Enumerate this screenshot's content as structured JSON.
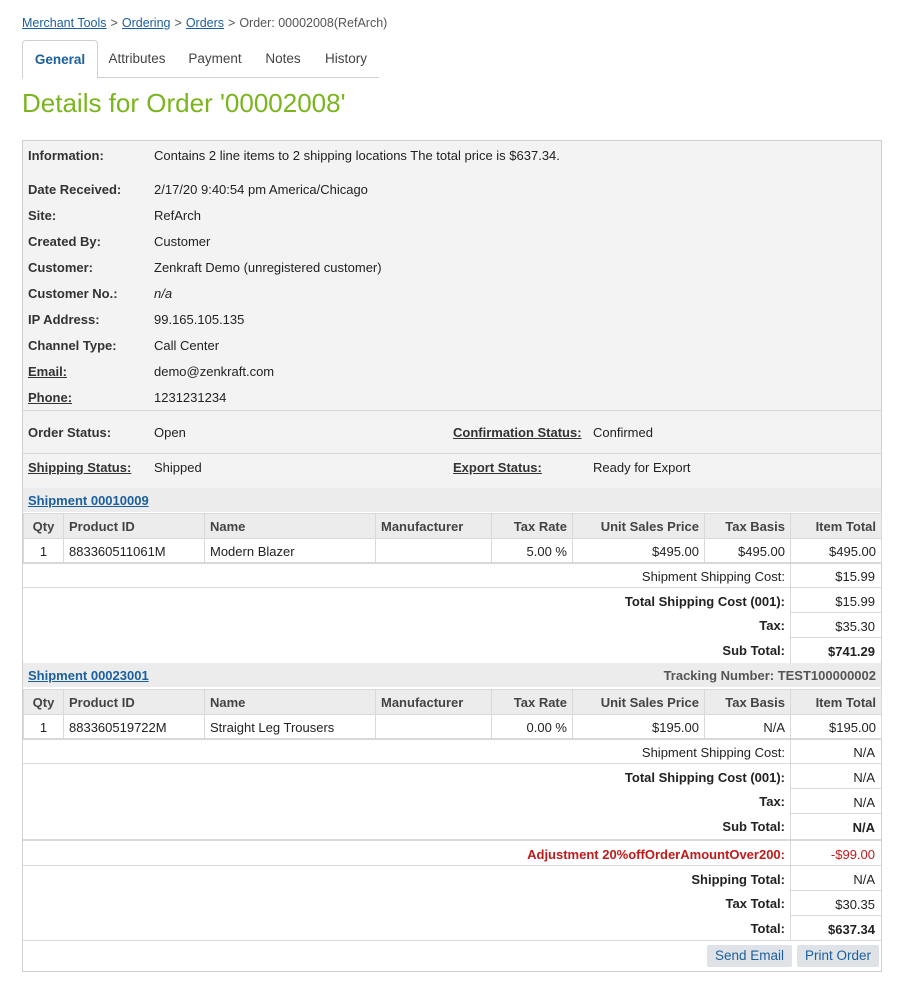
{
  "breadcrumb": {
    "merchant_tools": "Merchant Tools",
    "ordering": "Ordering",
    "orders": "Orders",
    "current": "Order: 00002008(RefArch)",
    "sep": ">"
  },
  "tabs": [
    "General",
    "Attributes",
    "Payment",
    "Notes",
    "History"
  ],
  "title": "Details for Order '00002008'",
  "info": {
    "information_label": "Information:",
    "information_value": "Contains 2 line items to 2 shipping locations The total price is $637.34.",
    "date_label": "Date Received:",
    "date_value": "2/17/20 9:40:54 pm America/Chicago",
    "site_label": "Site:",
    "site_value": "RefArch",
    "created_label": "Created By:",
    "created_value": "Customer",
    "customer_label": "Customer:",
    "customer_value": "Zenkraft Demo (unregistered customer)",
    "customer_no_label": "Customer No.:",
    "customer_no_value": "n/a",
    "ip_label": "IP Address:",
    "ip_value": "99.165.105.135",
    "channel_label": "Channel Type:",
    "channel_value": "Call Center",
    "email_label": "Email:",
    "email_value": "demo@zenkraft.com",
    "phone_label": "Phone:",
    "phone_value": "1231231234"
  },
  "status": {
    "order_label": "Order Status:",
    "order_value": "Open",
    "confirmation_label": "Confirmation Status:",
    "confirmation_value": "Confirmed",
    "shipping_label": "Shipping Status:",
    "shipping_value": "Shipped",
    "export_label": "Export Status:",
    "export_value": "Ready for Export"
  },
  "columns": [
    "Qty",
    "Product ID",
    "Name",
    "Manufacturer",
    "Tax Rate",
    "Unit Sales Price",
    "Tax Basis",
    "Item Total"
  ],
  "shipment1": {
    "name": "Shipment 00010009",
    "item": {
      "qty": "1",
      "product_id": "883360511061M",
      "name": "Modern Blazer",
      "manufacturer": "",
      "tax_rate": "5.00 %",
      "unit_price": "$495.00",
      "tax_basis": "$495.00",
      "item_total": "$495.00"
    },
    "ship_cost_label": "Shipment Shipping Cost:",
    "ship_cost": "$15.99",
    "total_ship_label": "Total Shipping Cost (001):",
    "total_ship": "$15.99",
    "tax_label": "Tax:",
    "tax": "$35.30",
    "subtotal_label": "Sub Total:",
    "subtotal": "$741.29"
  },
  "shipment2": {
    "name": "Shipment 00023001",
    "tracking": "Tracking Number: TEST100000002",
    "item": {
      "qty": "1",
      "product_id": "883360519722M",
      "name": "Straight Leg Trousers",
      "manufacturer": "",
      "tax_rate": "0.00 %",
      "unit_price": "$195.00",
      "tax_basis": "N/A",
      "item_total": "$195.00"
    },
    "ship_cost_label": "Shipment Shipping Cost:",
    "ship_cost": "N/A",
    "total_ship_label": "Total Shipping Cost (001):",
    "total_ship": "N/A",
    "tax_label": "Tax:",
    "tax": "N/A",
    "subtotal_label": "Sub Total:",
    "subtotal": "N/A"
  },
  "totals": {
    "adjustment_label": "Adjustment 20%offOrderAmountOver200:",
    "adjustment": "-$99.00",
    "shipping_total_label": "Shipping Total:",
    "shipping_total": "N/A",
    "tax_total_label": "Tax Total:",
    "tax_total": "$30.35",
    "total_label": "Total:",
    "total": "$637.34"
  },
  "buttons": {
    "send_email": "Send Email",
    "print_order": "Print Order"
  },
  "colors": {
    "title_green": "#7ab51d",
    "link_blue": "#1a5f9e",
    "adjustment_red": "#c01b1b"
  }
}
